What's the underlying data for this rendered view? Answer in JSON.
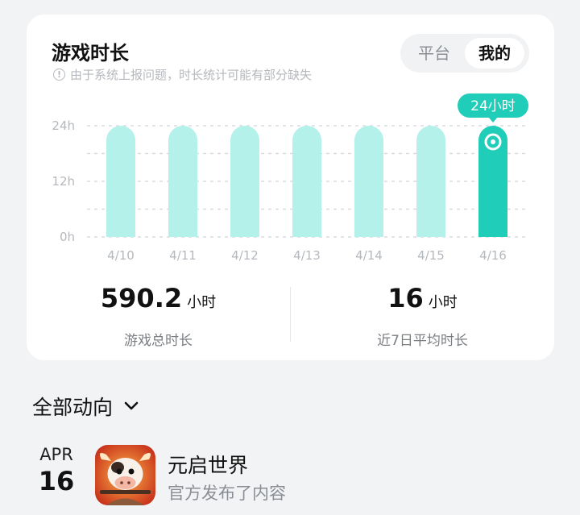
{
  "header": {
    "title": "游戏时长",
    "notice": "由于系统上报问题，时长统计可能有部分缺失",
    "toggle": {
      "options": [
        "平台",
        "我的"
      ],
      "selected": "我的"
    }
  },
  "chart_data": {
    "type": "bar",
    "categories": [
      "4/10",
      "4/11",
      "4/12",
      "4/13",
      "4/14",
      "4/15",
      "4/16"
    ],
    "values": [
      24,
      24,
      24,
      24,
      24,
      24,
      24
    ],
    "highlight_index": 6,
    "tooltip": "24小时",
    "yticks": [
      "24h",
      "12h",
      "0h"
    ],
    "ylim": [
      0,
      24
    ],
    "colors": {
      "bar": "#b4f1ea",
      "highlight": "#1fcdb8",
      "grid": "#d9dbdf",
      "tick": "#b5b8bd"
    }
  },
  "stats": {
    "total": {
      "value": "590.2",
      "unit": "小时",
      "label": "游戏总时长"
    },
    "average": {
      "value": "16",
      "unit": "小时",
      "label": "近7日平均时长"
    }
  },
  "feed": {
    "filter_label": "全部动向",
    "items": [
      {
        "month": "APR",
        "day": "16",
        "game": "元启世界",
        "action": "官方发布了内容",
        "icon": "game-cow-icon"
      }
    ]
  }
}
